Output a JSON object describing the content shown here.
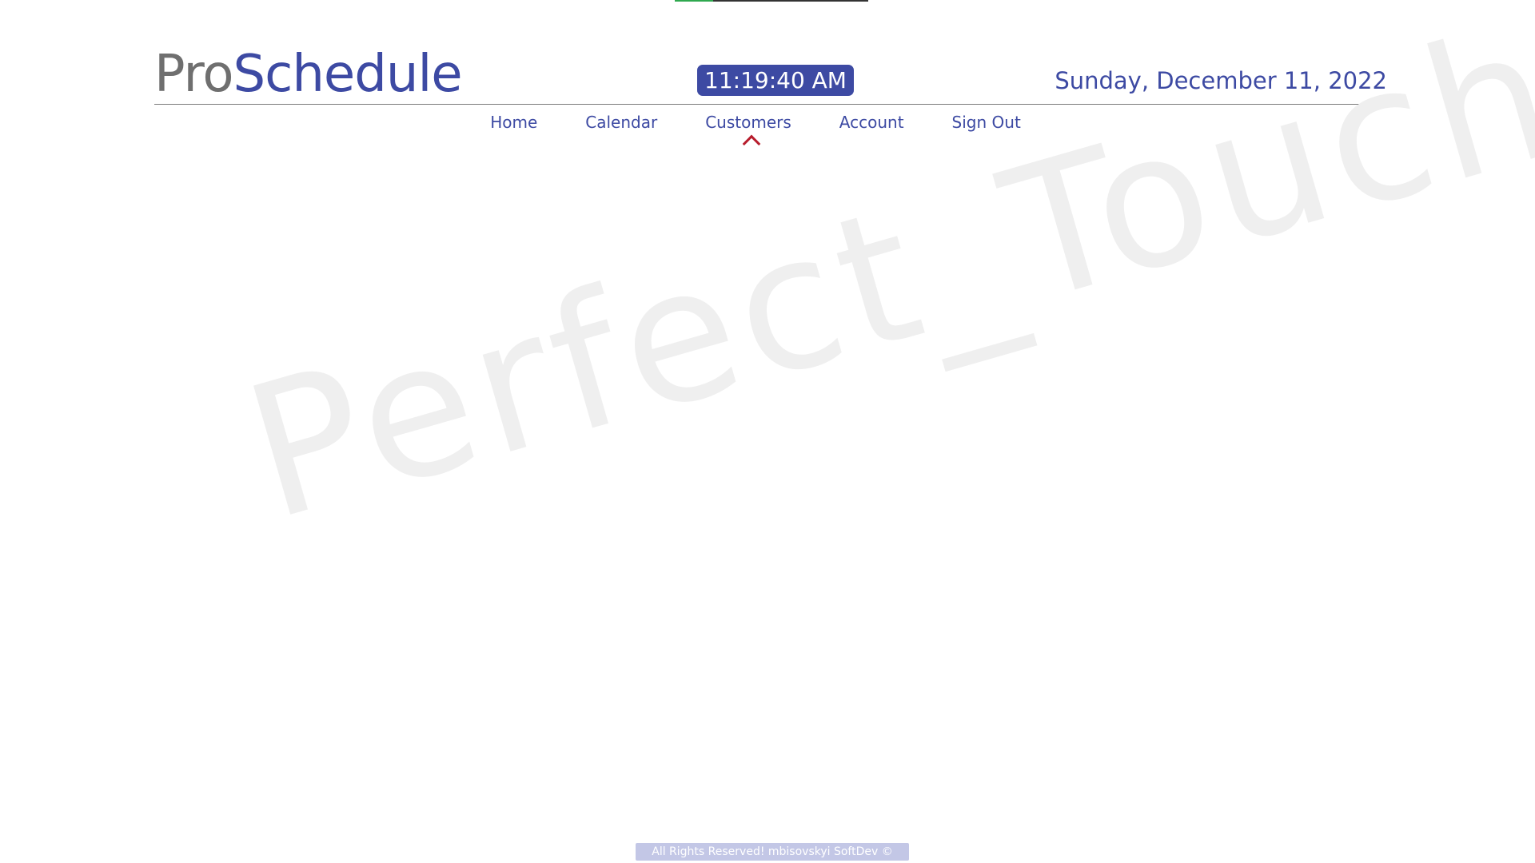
{
  "loading_bar": {
    "progress": 0.2,
    "fill_color": "#2fa84f"
  },
  "header": {
    "brand_prefix": "Pro",
    "brand_suffix": "Schedule",
    "clock": "11:19:40 AM",
    "date": "Sunday, December 11, 2022"
  },
  "nav": {
    "items": [
      {
        "label": "Home"
      },
      {
        "label": "Calendar"
      },
      {
        "label": "Customers",
        "active": true
      },
      {
        "label": "Account"
      },
      {
        "label": "Sign Out"
      }
    ],
    "active_indicator_icon": "chevron-up-icon",
    "active_color": "#b71c2c"
  },
  "watermark": {
    "text": "Perfect_Touch"
  },
  "footer": {
    "text": "All Rights Reserved! mbisovskyi SoftDev ©"
  },
  "colors": {
    "brand_blue": "#3d4aa3",
    "brand_gray": "#6f6f6f",
    "footer_bg": "#c3c7e6"
  }
}
